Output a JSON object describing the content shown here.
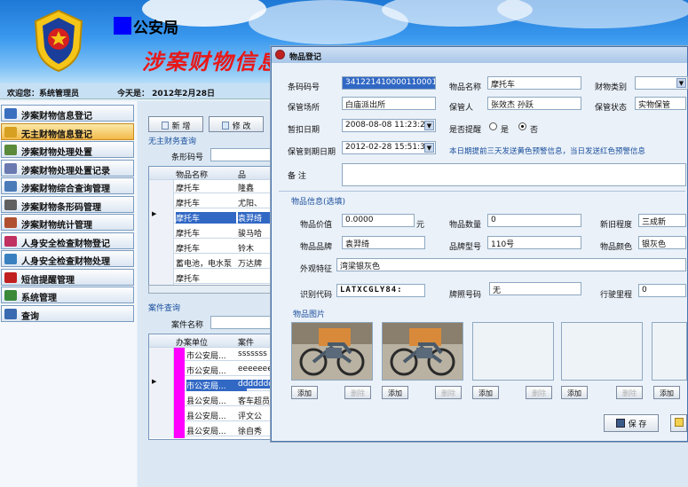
{
  "header": {
    "bureau": "公安局",
    "system_title": "涉案财物信息"
  },
  "status": {
    "welcome": "欢迎您：系统管理员",
    "today": "今天是： 2012年2月28日"
  },
  "sidebar": {
    "items": [
      {
        "label": "涉案财物信息登记",
        "color": "#3a6fc0"
      },
      {
        "label": "无主财物信息登记",
        "color": "#d8a020"
      },
      {
        "label": "涉案财物处理处置",
        "color": "#5a8a3a"
      },
      {
        "label": "涉案财物处理处置记录",
        "color": "#6a7ab0"
      },
      {
        "label": "涉案财物综合查询管理",
        "color": "#4a7ab8"
      },
      {
        "label": "涉案财物条形码管理",
        "color": "#606060"
      },
      {
        "label": "涉案财物统计管理",
        "color": "#b05030"
      },
      {
        "label": "人身安全检查财物登记",
        "color": "#c03060"
      },
      {
        "label": "人身安全检查财物处理",
        "color": "#3a80c0"
      },
      {
        "label": "短信提醒管理",
        "color": "#c02020"
      },
      {
        "label": "系统管理",
        "color": "#3a8a3a"
      },
      {
        "label": "查询",
        "color": "#3a6ab0"
      }
    ]
  },
  "main": {
    "add_label": "新 增",
    "edit_label": "修 改",
    "unowned_title": "无主财务查询",
    "barcode_label": "条形码号",
    "grid1": {
      "headers": [
        "物品名称",
        "品"
      ],
      "rows": [
        [
          "摩托车",
          "隆鑫"
        ],
        [
          "摩托车",
          "尤阳、"
        ],
        [
          "摩托车",
          "袁羿绮"
        ],
        [
          "摩托车",
          "骏马哈"
        ],
        [
          "摩托车",
          "铃木"
        ],
        [
          "蓄电池，电水泵",
          "万达牌"
        ],
        [
          "摩托车",
          ""
        ]
      ]
    },
    "case_title": "案件查询",
    "case_name_label": "案件名称",
    "grid2": {
      "headers": [
        "办案单位",
        "案件"
      ],
      "rows": [
        [
          "市公安局...",
          "sssssss"
        ],
        [
          "市公安局...",
          "eeeeeeee"
        ],
        [
          "市公安局...",
          "dddddddd"
        ],
        [
          "县公安局...",
          "客车超员"
        ],
        [
          "县公安局...",
          "评文公"
        ],
        [
          "县公安局...",
          "徐自秀"
        ]
      ]
    }
  },
  "dialog": {
    "title": "物品登记",
    "labels": {
      "barcode": "条码码号",
      "item_name": "物品名称",
      "category": "财物类别",
      "storage_place": "保管场所",
      "keeper": "保管人",
      "storage_status": "保管状态",
      "seize_date": "暂扣日期",
      "remind": "是否提醒",
      "yes": "是",
      "no": "否",
      "due_date": "保管到期日期",
      "remind_note": "本日期提前三天发送黄色预警信息，当日发送红色预警信息",
      "remarks": "备  注",
      "item_info": "物品信息",
      "optional": "(选填)",
      "value": "物品价值",
      "yuan": "元",
      "qty": "物品数量",
      "condition": "新旧程度",
      "brand": "物品品牌",
      "model": "品牌型号",
      "color": "物品颜色",
      "appearance": "外观特征",
      "id_code": "识别代码",
      "plate": "牌照号码",
      "mileage": "行驶里程",
      "photos": "物品图片",
      "add": "添加",
      "delete": "删除",
      "save": "保 存"
    },
    "values": {
      "barcode": "341221410000110001",
      "item_name": "摩托车",
      "category": "",
      "storage_place": "白庙派出所",
      "keeper": "张效杰  孙跃",
      "storage_status": "实物保管",
      "seize_date": "2008-08-08 11:23:25",
      "due_date": "2012-02-28 15:51:38",
      "remarks": "",
      "value": "0.0000",
      "qty": "0",
      "condition": "三成新",
      "brand": "袁羿绮",
      "model": "110号",
      "color": "银灰色",
      "appearance": "湾梁银灰色",
      "id_code": "LATXCGLY84:",
      "plate": "无",
      "mileage": "0"
    }
  }
}
